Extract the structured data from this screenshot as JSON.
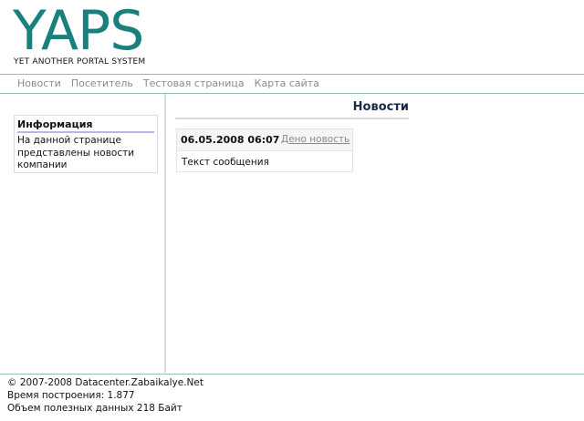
{
  "header": {
    "logo": "YAPS",
    "tagline": "YET ANOTHER PORTAL SYSTEM"
  },
  "nav": {
    "items": [
      {
        "label": "Новости"
      },
      {
        "label": "Посетитель"
      },
      {
        "label": "Тестовая страница"
      },
      {
        "label": "Карта сайта"
      }
    ]
  },
  "sidebar": {
    "info": {
      "title": "Информация",
      "text": "На данной странице представлены новости компании"
    }
  },
  "main": {
    "title": "Новости",
    "news": [
      {
        "date": "06.05.2008 06:07",
        "link_label": "Дено новость",
        "body": "Текст сообщения"
      }
    ]
  },
  "footer": {
    "copyright": "© 2007-2008 Datacenter.Zabaikalye.Net",
    "build_time": "Время построения: 1.877",
    "payload": "Объем полезных данных 218 Байт"
  },
  "colors": {
    "logo": "#1a807e",
    "rule": "#8fbcb9",
    "nav_text": "#8a8a8a",
    "title_underline": "#b7b7e8"
  }
}
